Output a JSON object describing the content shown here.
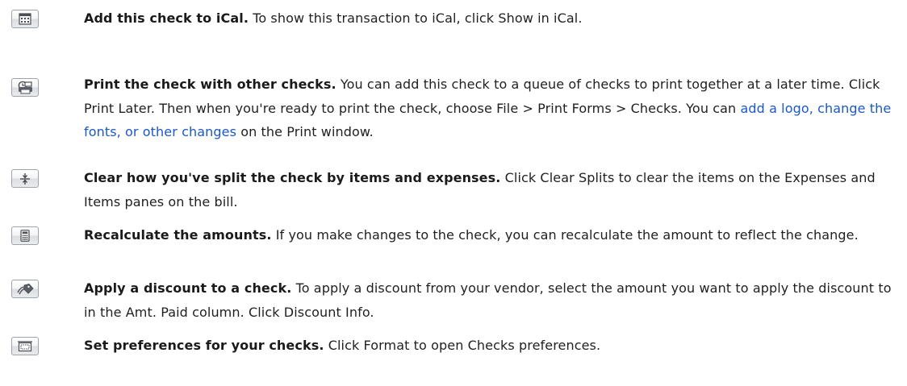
{
  "items": [
    {
      "icon": "calendar-icon",
      "title": "Add this check to iCal.",
      "description": "To show this transaction to iCal, click Show in iCal."
    },
    {
      "icon": "print-later-icon",
      "title": "Print the check with other checks.",
      "description_before_link": "You can add this check to a queue of checks to print together at a later time. Click Print Later. Then when you're ready to print the check, choose File > Print Forms > Checks. You can",
      "link_text": "add a logo, change the fonts, or other changes",
      "description_after_link": "on the Print window."
    },
    {
      "icon": "clear-splits-icon",
      "title": "Clear how you've split the check by items and expenses.",
      "description": "Click Clear Splits to clear the items on the Expenses and Items panes on the bill."
    },
    {
      "icon": "calculator-icon",
      "title": "Recalculate the amounts.",
      "description": "If you make changes to the check, you can recalculate the amount to reflect the change."
    },
    {
      "icon": "discount-tag-icon",
      "title": "Apply a discount to a check.",
      "description": "To apply a discount from your vendor, select the amount you want to apply the discount to in the Amt. Paid column. Click Discount Info."
    },
    {
      "icon": "format-icon",
      "title": "Set preferences for your checks.",
      "description": "Click Format to open Checks preferences."
    }
  ]
}
